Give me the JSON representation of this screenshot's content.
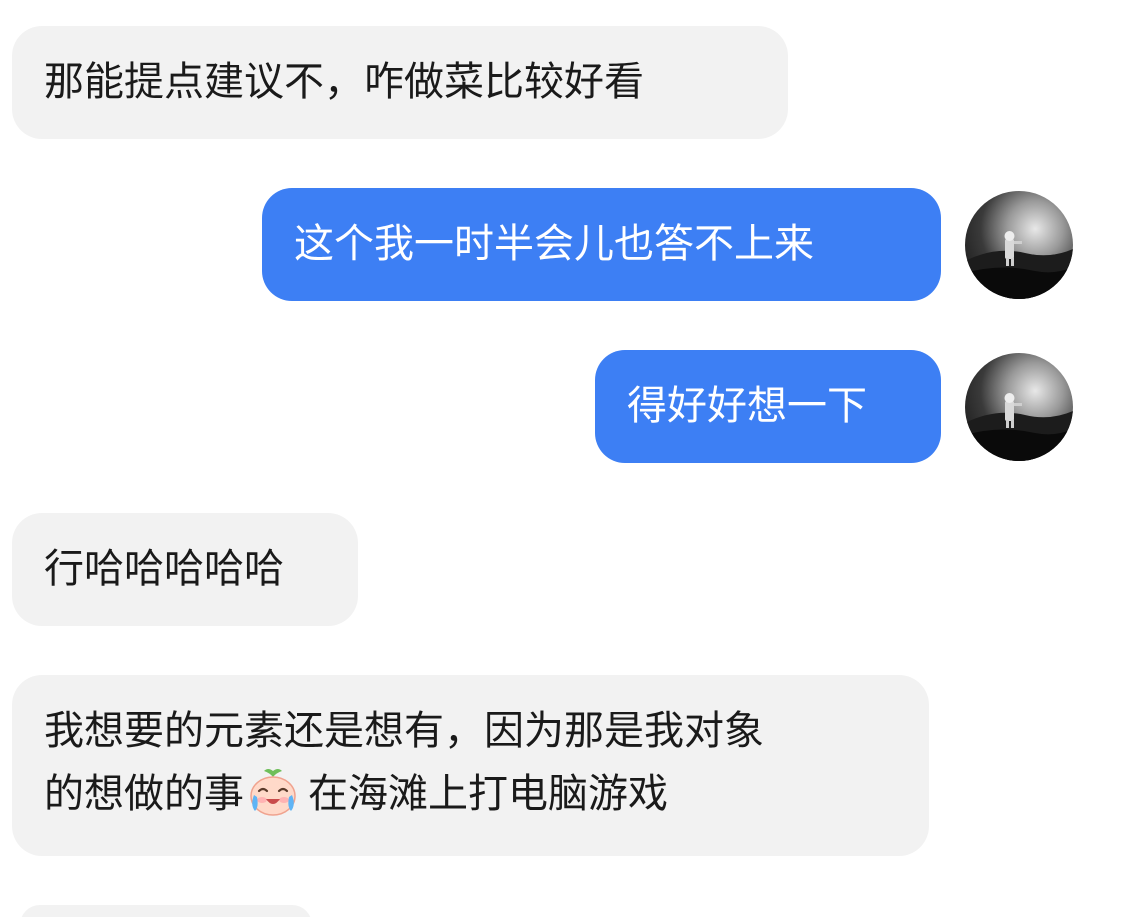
{
  "messages": [
    {
      "side": "in",
      "text": "那能提点建议不，咋做菜比较好看"
    },
    {
      "side": "out",
      "text": "这个我一时半会儿也答不上来"
    },
    {
      "side": "out",
      "text": "得好好想一下"
    },
    {
      "side": "in",
      "text": "行哈哈哈哈哈"
    },
    {
      "side": "in",
      "line1": "我想要的元素还是想有，因为那是我对象",
      "line2_before_emoji": "的想做的事",
      "emoji": "crying-laughing-peach-emoji",
      "line2_after_emoji": "在海滩上打电脑游戏"
    }
  ],
  "colors": {
    "incoming_bubble": "#f2f2f2",
    "outgoing_bubble": "#3d7ff4",
    "incoming_text": "#1a1a1a",
    "outgoing_text": "#ffffff"
  },
  "icons": {
    "avatar": "astronaut-avatar"
  }
}
